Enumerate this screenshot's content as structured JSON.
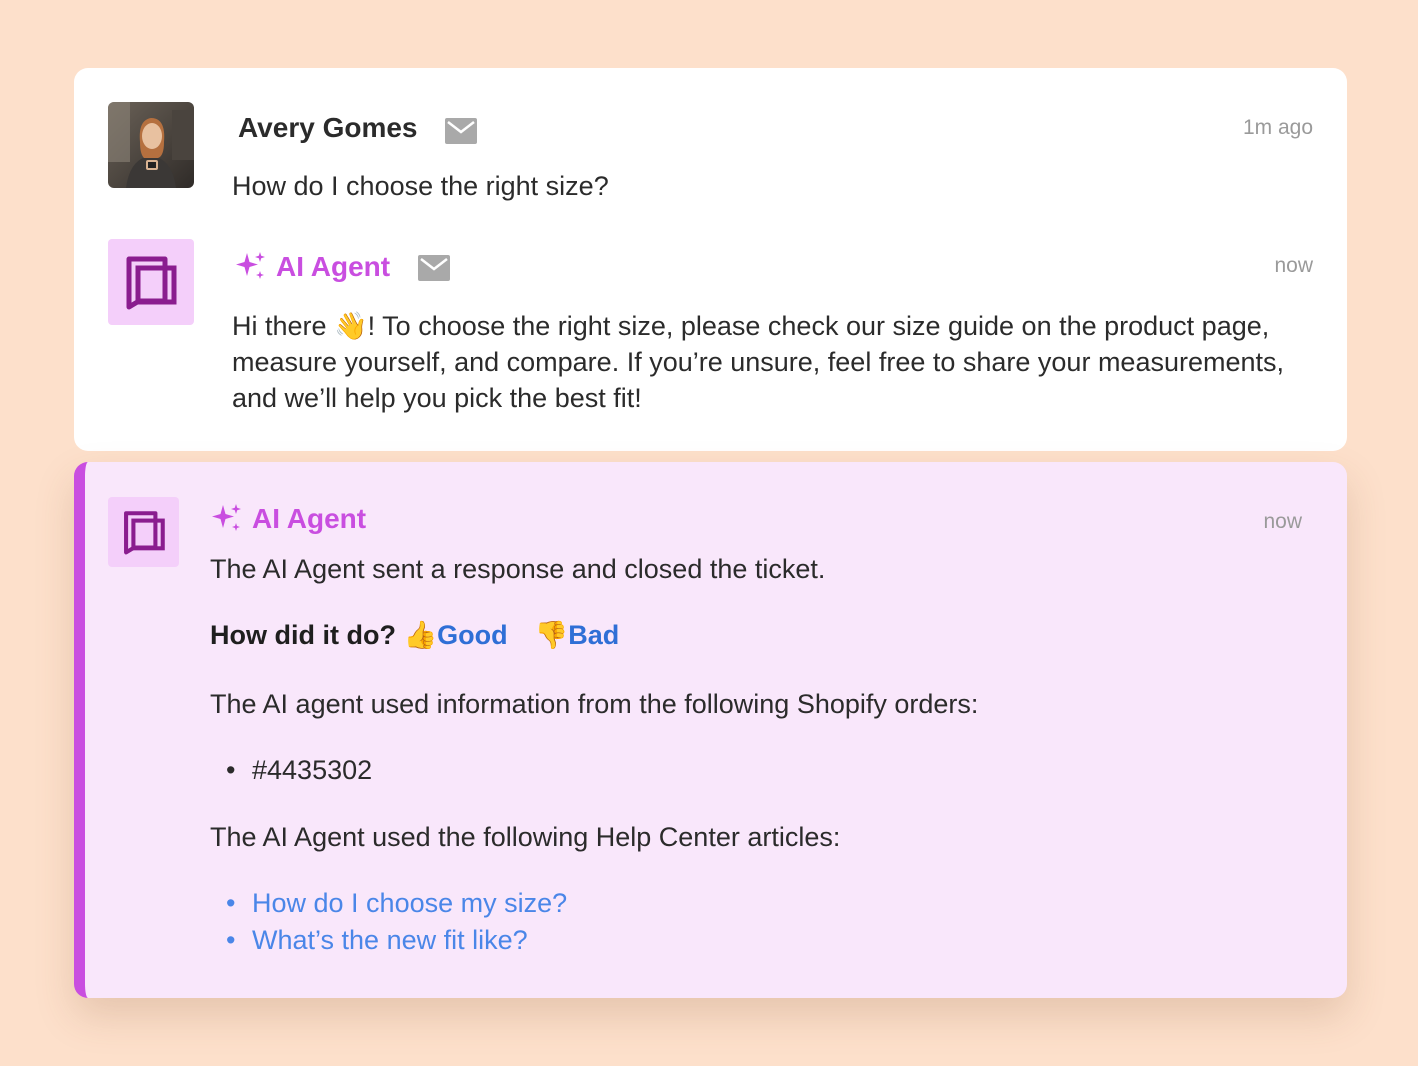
{
  "thread": [
    {
      "sender": "Avery Gomes",
      "time": "1m ago",
      "text": "How do I choose the right size?"
    },
    {
      "sender": "AI Agent",
      "time": "now",
      "text_before_emoji": "Hi there ",
      "emoji": "👋",
      "text_after_emoji": "! To choose the right size, please check our size guide on the product page, measure yourself, and compare. If you’re unsure, feel free to share your measurements, and we’ll help you pick the best fit!"
    }
  ],
  "note": {
    "sender": "AI Agent",
    "time": "now",
    "summary": "The AI Agent sent a response and closed the ticket.",
    "rating_question": "How did it do?",
    "good_emoji": "👍",
    "good_label": "Good",
    "bad_emoji": "👎",
    "bad_label": "Bad",
    "orders_heading": "The AI agent used information from the following Shopify orders:",
    "orders": [
      "#4435302"
    ],
    "articles_heading": "The AI Agent used the following Help Center articles:",
    "articles": [
      "How do I choose my size?",
      "What’s the new fit like?"
    ]
  },
  "icons": {
    "mail": "mail-icon",
    "sparkle": "sparkle-icon",
    "agent_logo": "agent-logo-icon"
  },
  "colors": {
    "background": "#fde0cb",
    "agent_accent": "#c94ee0",
    "agent_avatar_bg": "#f4cffa",
    "note_bg": "#f9e7fb",
    "link": "#4a86e8",
    "rating_link": "#2f6fd6"
  }
}
